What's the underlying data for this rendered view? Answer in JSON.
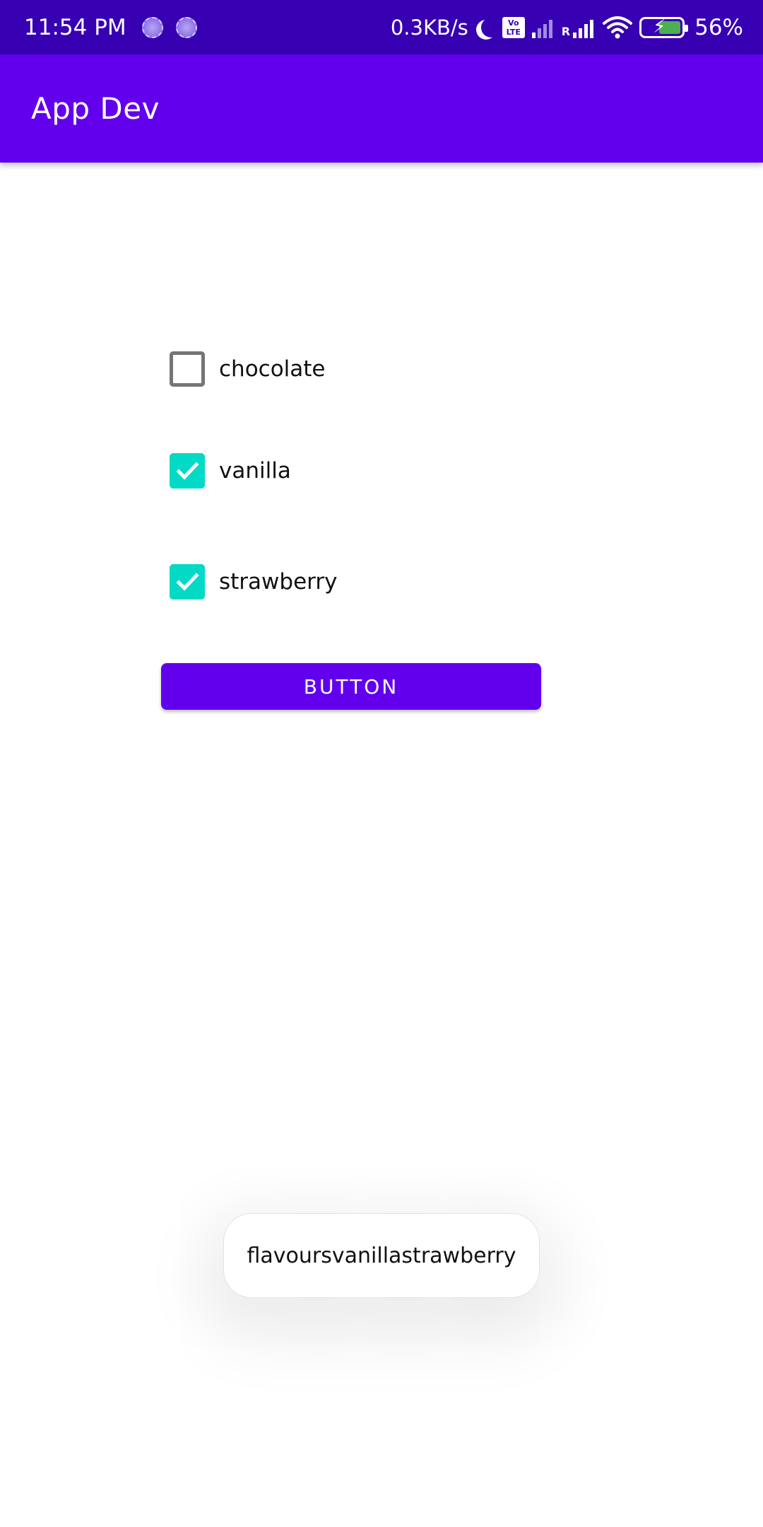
{
  "status_bar": {
    "time": "11:54 PM",
    "net_speed": "0.3KB/s",
    "volte_label": "Vo LTE",
    "roaming_label": "R",
    "battery_percent": "56%",
    "battery_level": 0.56,
    "icons": [
      "notification-icon",
      "notification-icon",
      "do-not-disturb-moon-icon",
      "volte-icon",
      "signal-icon",
      "signal-roaming-icon",
      "wifi-icon",
      "battery-charging-icon"
    ]
  },
  "app_bar": {
    "title": "App Dev",
    "color": "#6200ee"
  },
  "checkboxes": [
    {
      "label": "chocolate",
      "checked": false
    },
    {
      "label": "vanilla",
      "checked": true
    },
    {
      "label": "strawberry",
      "checked": true
    }
  ],
  "checkbox_color": "#03dac5",
  "button": {
    "label": "BUTTON"
  },
  "toast": {
    "text": "flavoursvanillastrawberry"
  }
}
